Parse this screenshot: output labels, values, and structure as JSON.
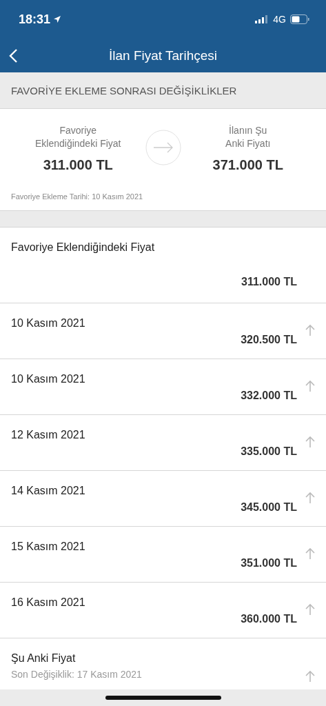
{
  "status_bar": {
    "time": "18:31",
    "network": "4G"
  },
  "nav": {
    "title": "İlan Fiyat Tarihçesi"
  },
  "section_header": "FAVORİYE EKLEME SONRASI DEĞİŞİKLİKLER",
  "summary": {
    "from_label": "Favoriye Eklendiğindeki Fiyat",
    "from_price": "311.000 TL",
    "to_label": "İlanın Şu Anki Fiyatı",
    "to_price": "371.000 TL",
    "note": "Favoriye Ekleme Tarihi: 10 Kasım 2021"
  },
  "history": [
    {
      "kind": "start",
      "title": "Favoriye Eklendiğindeki Fiyat",
      "price": "311.000 TL",
      "rising": false
    },
    {
      "kind": "change",
      "title": "10 Kasım 2021",
      "price": "320.500 TL",
      "rising": true
    },
    {
      "kind": "change",
      "title": "10 Kasım 2021",
      "price": "332.000 TL",
      "rising": true
    },
    {
      "kind": "change",
      "title": "12 Kasım 2021",
      "price": "335.000 TL",
      "rising": true
    },
    {
      "kind": "change",
      "title": "14 Kasım 2021",
      "price": "345.000 TL",
      "rising": true
    },
    {
      "kind": "change",
      "title": "15 Kasım 2021",
      "price": "351.000 TL",
      "rising": true
    },
    {
      "kind": "change",
      "title": "16 Kasım 2021",
      "price": "360.000 TL",
      "rising": true
    },
    {
      "kind": "current",
      "title": "Şu Anki Fiyat",
      "subtitle": "Son Değişiklik: 17 Kasım 2021",
      "rising": true
    }
  ]
}
